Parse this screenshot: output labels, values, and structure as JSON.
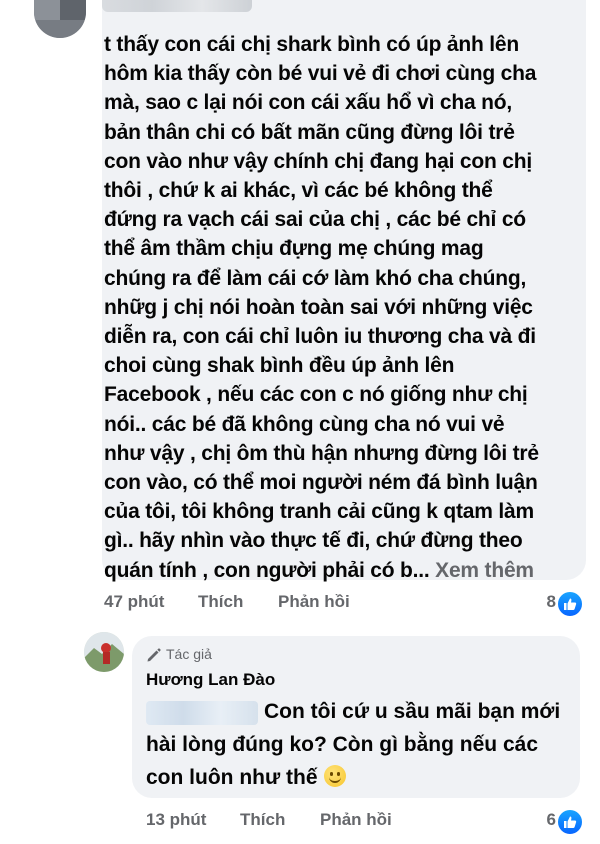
{
  "comment": {
    "lines": [
      "t thấy con cái chị shark bình có úp ảnh lên",
      "hôm kia thấy còn bé vui vẻ đi chơi cùng cha",
      "mà, sao c lại nói con cái xấu hổ vì cha nó,",
      "bản thân chi có bất mãn cũng đừng lôi trẻ",
      "con vào như vậy chính chị đang hại con chị",
      "thôi , chứ k ai khác, vì các bé không thể",
      "đứng ra vạch cái sai của chị , các bé chỉ có",
      "thể âm thầm chịu đựng mẹ chúng mag",
      "chúng ra để làm cái cớ làm khó cha chúng,",
      "nhữg j chị nói hoàn toàn sai với những việc",
      "diễn ra, con cái chỉ luôn iu thương cha và đi",
      "choi cùng shak bình đều úp ảnh lên",
      "Facebook , nếu các con c nó giống như chị",
      "nói.. các bé đã không cùng cha nó vui vẻ",
      "như vậy , chị ôm thù hận nhưng đừng lôi trẻ",
      "con vào, có thể moi người ném đá bình luận",
      "của tôi, tôi không tranh cải cũng k qtam làm",
      "gì..  hãy nhìn vào thực tế đi, chứ đừng theo"
    ],
    "last_line": "quán tính , con người phải có b...",
    "see_more": "Xem thêm",
    "time": "47 phút",
    "like_label": "Thích",
    "reply_label": "Phản hồi",
    "reaction_count": "8"
  },
  "reply": {
    "author_badge": "Tác giả",
    "name": "Hương Lan Đào",
    "lines": [
      "Con tôi cứ u sầu mãi bạn mới",
      "hài lòng đúng ko?  Còn gì bằng nếu các",
      "con luôn như thế"
    ],
    "emoji": "smile-emoji",
    "time": "13 phút",
    "like_label": "Thích",
    "reply_label": "Phản hồi",
    "reaction_count": "6"
  },
  "colors": {
    "bubble": "#f0f2f5",
    "secondary_text": "#65676b",
    "like_blue": "#0866ff"
  }
}
